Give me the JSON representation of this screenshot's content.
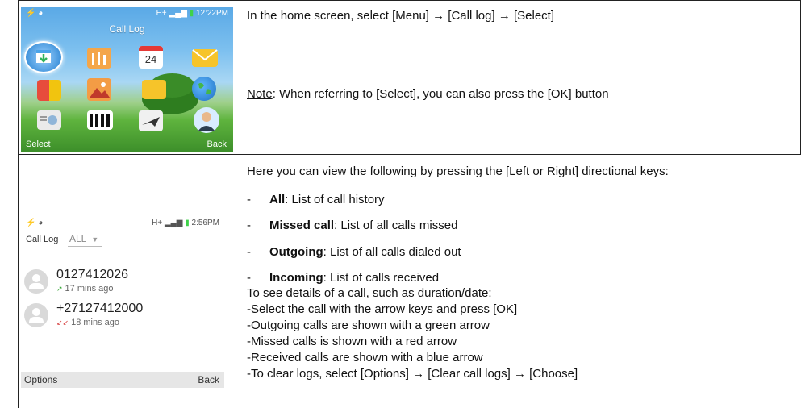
{
  "row1": {
    "instruction": "In the home screen, select [Menu] → [Call log] → [Select]",
    "note_label": "Note",
    "note_text": ": When referring to [Select], you can also press the [OK] button",
    "phone": {
      "status_left": "⚡ ◕",
      "status_right": "12:22PM",
      "network": "H+",
      "title": "Call Log",
      "calendar_day": "24",
      "soft_left": "Select",
      "soft_right": "Back"
    }
  },
  "row2": {
    "intro": "Here you can view the following by pressing the [Left or Right] directional keys:",
    "options": [
      {
        "dash": "-",
        "name": "All",
        "desc": ": List of call history"
      },
      {
        "dash": "-",
        "name": "Missed call",
        "desc": ": List of all calls missed"
      },
      {
        "dash": "-",
        "name": "Outgoing",
        "desc": ": List of all calls dialed out"
      },
      {
        "dash": "-",
        "name": "Incoming",
        "desc": ": List of calls received"
      }
    ],
    "details": [
      "To see details of a call, such as duration/date:",
      "-Select the call with the arrow keys and press [OK]",
      "-Outgoing calls are shown with a green arrow",
      "-Missed calls is shown with a red arrow",
      "-Received calls are shown with a blue arrow",
      "-To clear logs, select [Options] → [Clear call logs] → [Choose]"
    ],
    "phone": {
      "status_left": "⚡ ◕",
      "network": "H+",
      "status_right": "2:56PM",
      "header_title": "Call Log",
      "filter_value": "ALL",
      "calls": [
        {
          "number": "0127412026",
          "time": "17 mins ago",
          "arrow": "↗"
        },
        {
          "number": "+27127412000",
          "time": "18 mins ago",
          "arrow": "↙↙"
        }
      ],
      "soft_left": "Options",
      "soft_right": "Back"
    }
  },
  "colors": {
    "outgoing_arrow": "#3aa83a",
    "missed_arrow": "#d63a3a",
    "received_arrow": "#3a7fd6"
  }
}
